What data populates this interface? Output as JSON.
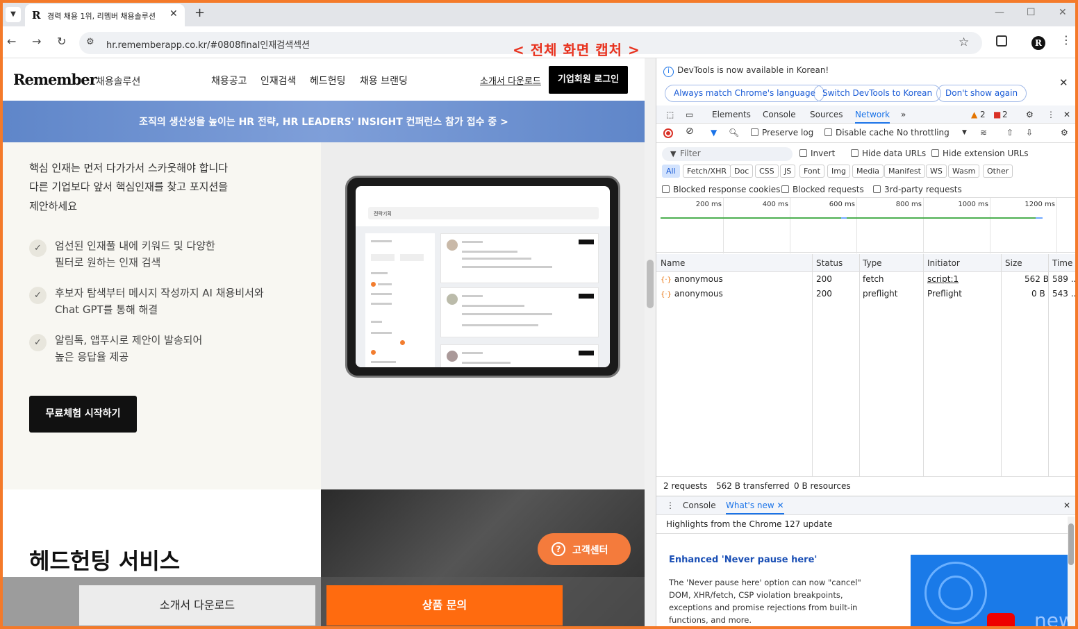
{
  "browser": {
    "tab_title": "경력 채용 1위, 리멤버 채용솔루션",
    "tab_favicon": "R",
    "url": "hr.rememberapp.co.kr/#0808final인재검색섹션",
    "capture_label": "< 전체 화면 캡처 >",
    "profile_letter": "R"
  },
  "site": {
    "logo": "Remember",
    "logo_sub": "채용솔루션",
    "nav": [
      "채용공고",
      "인재검색",
      "헤드헌팅",
      "채용 브랜딩"
    ],
    "intro_download": "소개서 다운로드",
    "login": "기업회원 로그인",
    "banner": "조직의 생산성을 높이는 HR 전략, HR LEADERS' INSIGHT 컨퍼런스 참가 접수 중  >",
    "lead_lines": [
      "핵심 인재는 먼저 다가가서 스카웃해야 합니다",
      "다른 기업보다 앞서 핵심인재를 찾고 포지션을",
      "제안하세요"
    ],
    "features": [
      {
        "line1": "엄선된 인재풀 내에 키워드 및 다양한",
        "line2": "필터로 원하는 인재 검색"
      },
      {
        "line1": "후보자 탐색부터 메시지 작성까지 AI 채용비서와",
        "line2": "Chat GPT를 통해 해결"
      },
      {
        "line1": "알림톡, 앱푸시로 제안이 발송되어",
        "line2": "높은 응답율 제공"
      }
    ],
    "trial_button": "무료체험 시작하기",
    "tablet_search": "전략기획",
    "headhunting_title": "헤드헌팅 서비스",
    "customer_center": "고객센터",
    "bottom_download": "소개서 다운로드",
    "bottom_inquiry": "상품 문의"
  },
  "devtools": {
    "info_text": "DevTools is now available in Korean!",
    "info_buttons": [
      "Always match Chrome's language",
      "Switch DevTools to Korean",
      "Don't show again"
    ],
    "tabs": [
      "Elements",
      "Console",
      "Sources",
      "Network"
    ],
    "warnings": "2",
    "errors": "2",
    "preserve_log": "Preserve log",
    "disable_cache": "Disable cache",
    "throttling": "No throttling",
    "filter_placeholder": "Filter",
    "invert": "Invert",
    "hide_data_urls": "Hide data URLs",
    "hide_ext_urls": "Hide extension URLs",
    "filter_types": [
      "All",
      "Fetch/XHR",
      "Doc",
      "CSS",
      "JS",
      "Font",
      "Img",
      "Media",
      "Manifest",
      "WS",
      "Wasm",
      "Other"
    ],
    "blocked_cookies": "Blocked response cookies",
    "blocked_requests": "Blocked requests",
    "third_party": "3rd-party requests",
    "timeline_ticks": [
      "200 ms",
      "400 ms",
      "600 ms",
      "800 ms",
      "1000 ms",
      "1200 ms"
    ],
    "columns": [
      "Name",
      "Status",
      "Type",
      "Initiator",
      "Size",
      "Time"
    ],
    "rows": [
      {
        "name": "anonymous",
        "status": "200",
        "type": "fetch",
        "initiator": "script:1",
        "size": "562 B",
        "time": "589 ..."
      },
      {
        "name": "anonymous",
        "status": "200",
        "type": "preflight",
        "initiator": "Preflight",
        "size": "0 B",
        "time": "543 ..."
      }
    ],
    "summary": [
      "2 requests",
      "562 B transferred",
      "0 B resources"
    ],
    "drawer_tabs": [
      "Console",
      "What's new"
    ],
    "highlights": "Highlights from the Chrome 127 update",
    "whatsnew_title": "Enhanced 'Never pause here'",
    "whatsnew_body": "The 'Never pause here' option can now \"cancel\" DOM, XHR/fetch, CSP violation breakpoints, exceptions and promise rejections from built-in functions, and more.",
    "whatsnew_image_text": "new"
  }
}
